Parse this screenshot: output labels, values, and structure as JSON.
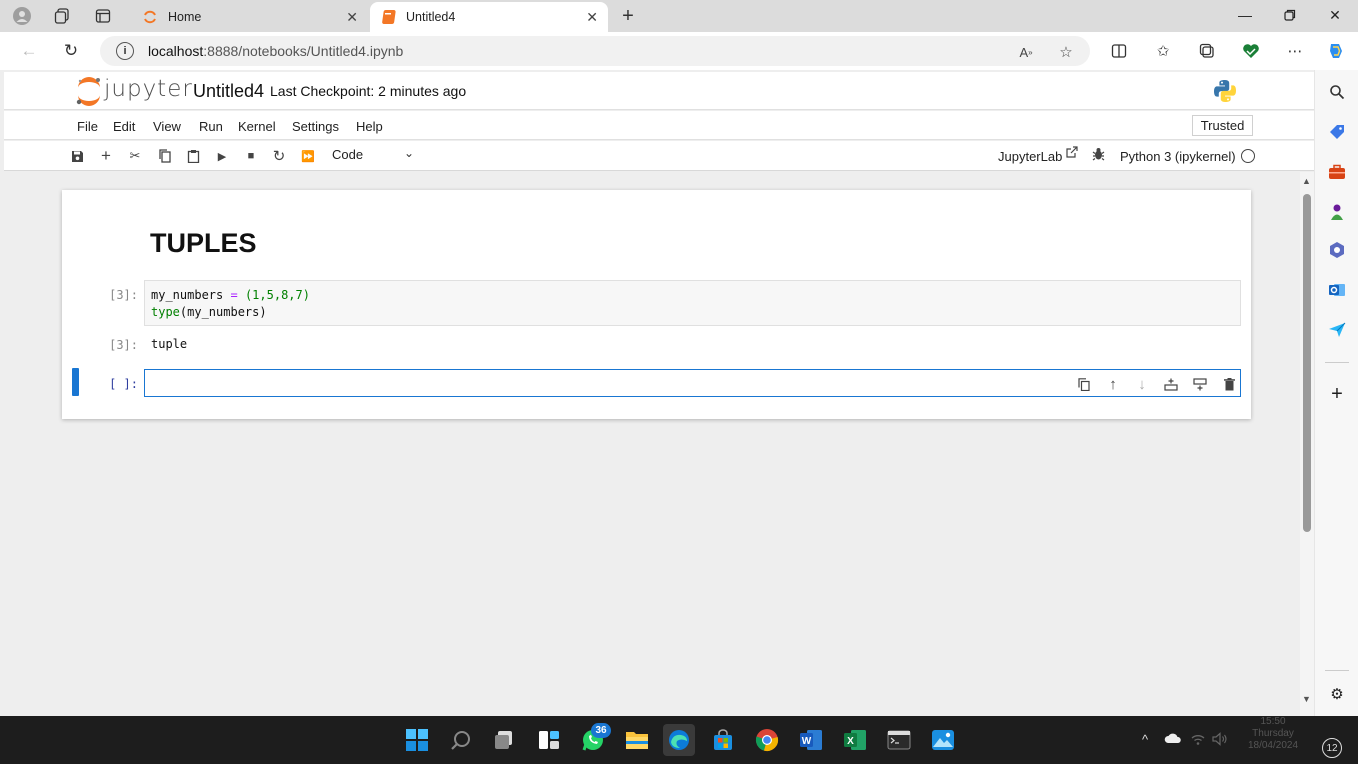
{
  "browser": {
    "tabs": [
      {
        "title": "Home",
        "active": false
      },
      {
        "title": "Untitled4",
        "active": true
      }
    ],
    "new_tab_icon": "plus-icon",
    "window_controls": [
      "minimize-icon",
      "restore-icon",
      "close-icon"
    ]
  },
  "address_bar": {
    "url_host": "localhost",
    "url_rest": ":8888/notebooks/Untitled4.ipynb",
    "read_aloud_label": "A¹⁾"
  },
  "jupyter": {
    "logo_text": "jupyter",
    "notebook_title": "Untitled4",
    "checkpoint": "Last Checkpoint: 2 minutes ago",
    "menu": [
      "File",
      "Edit",
      "View",
      "Run",
      "Kernel",
      "Settings",
      "Help"
    ],
    "trusted_label": "Trusted",
    "toolbar": {
      "cell_type": "Code",
      "jupyterlab_label": "JupyterLab",
      "kernel_name": "Python 3 (ipykernel)"
    },
    "cells": {
      "markdown_heading": "TUPLES",
      "code1_prompt": "[3]:",
      "code1_line1_var": "my_numbers",
      "code1_line1_op": "=",
      "code1_line1_rest": "(1,5,8,7)",
      "code1_line2_func": "type",
      "code1_line2_arg": "(my_numbers)",
      "output1_prompt": "[3]:",
      "output1_text": "tuple",
      "code2_prompt": "[ ]:"
    }
  },
  "taskbar": {
    "whatsapp_badge": "36",
    "clock_time": "15:50",
    "clock_day": "Thursday",
    "clock_date": "18/04/2024",
    "notification_count": "12"
  },
  "colors": {
    "accent_blue": "#1976d2",
    "jupyter_orange": "#f37726",
    "taskbar_bg": "#1d1d1d"
  }
}
